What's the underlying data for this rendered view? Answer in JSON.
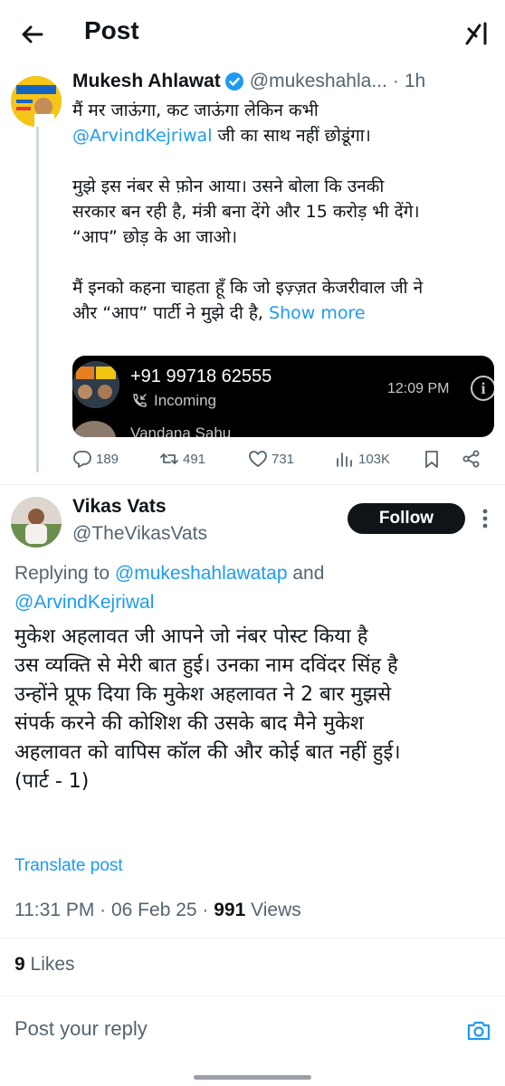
{
  "header": {
    "title": "Post",
    "back_icon": "arrow-left-icon",
    "grok_icon": "grok-icon"
  },
  "tweet": {
    "author_name": "Mukesh Ahlawat",
    "verified_icon": "verified-badge-icon",
    "handle": "@mukeshahla...",
    "separator": "·",
    "time": "1h",
    "line1": "मैं मर जाऊंगा, कट जाऊंगा लेकिन कभी",
    "mention": "@ArvindKejriwal",
    "line2_rest": " जी का साथ नहीं छोडूंगा।",
    "line3": "मुझे इस नंबर से फ़ोन आया। उसने बोला कि उनकी",
    "line4": "सरकार बन रही है, मंत्री बना देंगे और 15 करोड़ भी देंगे।",
    "line5": "“आप” छोड़ के आ जाओ।",
    "line6": "मैं इनको कहना चाहता हूँ कि जो इज़्ज़त केजरीवाल जी ने",
    "line7": "और “आप” पार्टी ने मुझे दी है, ",
    "show_more": "Show more",
    "media": {
      "phone_number": "+91 99718 62555",
      "call_type": "Incoming",
      "call_time": "12:09 PM",
      "info_glyph": "i",
      "next_contact_partial": "Vandana Sahu"
    },
    "actions": {
      "replies": "189",
      "reposts": "491",
      "likes": "731",
      "views": "103K"
    }
  },
  "reply": {
    "author_name": "Vikas Vats",
    "handle": "@TheVikasVats",
    "follow_label": "Follow",
    "replying_prefix": "Replying to ",
    "replying_to_1": "@mukeshahlawatap",
    "replying_and": " and",
    "replying_to_2": "@ArvindKejriwal",
    "body_lines": [
      "मुकेश अहलावत जी आपने जो नंबर पोस्ट किया है",
      "उस व्यक्ति से मेरी बात हुई। उनका नाम दविंदर सिंह है",
      "उन्होंने प्रूफ दिया कि मुकेश अहलावत ने 2 बार मुझसे",
      "संपर्क करने की कोशिश की उसके बाद मैने मुकेश",
      "अहलावत को वापिस कॉल की और कोई बात नहीं हुई।",
      "(पार्ट - 1)"
    ],
    "translate_label": "Translate post",
    "timestamp": "11:31 PM · 06 Feb 25 · ",
    "views_count": "991",
    "views_label": " Views",
    "likes_count": "9",
    "likes_label": " Likes"
  },
  "composer": {
    "placeholder": "Post your reply",
    "camera_icon": "camera-icon"
  },
  "colors": {
    "accent": "#1d9bf0",
    "text_primary": "#0f1419",
    "text_secondary": "#536471",
    "border": "#eff3f4"
  }
}
